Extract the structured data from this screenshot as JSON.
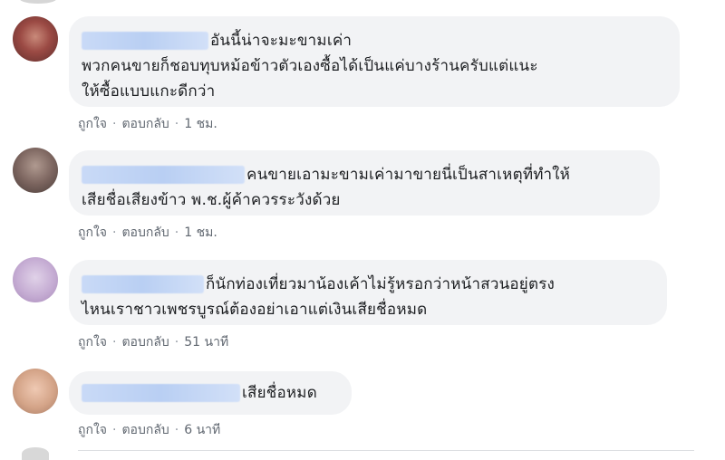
{
  "comments": [
    {
      "lines": [
        "อันนี้น่าจะมะขามเค่า",
        "พวกคนขายก็ชอบทุบหม้อข้าวตัวเองซื้อได้เป็นแค่บางร้านครับแต่แนะ",
        "ให้ซื้อแบบแกะดีกว่า"
      ],
      "like": "ถูกใจ",
      "reply": "ตอบกลับ",
      "time": "1 ชม.",
      "avatar_color": "#a0504a"
    },
    {
      "lines": [
        "คนขายเอามะขามเค่ามาขายนี่เป็นสาเหตุที่ทำให้",
        "เสียชื่อเสียงข้าว พ.ช.ผู้ค้าควรระวังด้วย"
      ],
      "like": "ถูกใจ",
      "reply": "ตอบกลับ",
      "time": "1 ชม.",
      "avatar_color": "#8a6f66"
    },
    {
      "lines": [
        "ก็นักท่องเที่ยวมาน้องเค้าไม่รู้หรอกว่าหน้าสวนอยู่ตรง",
        "ไหนเราชาวเพชรบูรณ์ต้องอย่าเอาแต่เงินเสียชื่อหมด"
      ],
      "like": "ถูกใจ",
      "reply": "ตอบกลับ",
      "time": "51 นาที",
      "avatar_color": "#c7b2d3"
    },
    {
      "lines": [
        "เสียชื่อหมด"
      ],
      "like": "ถูกใจ",
      "reply": "ตอบกลับ",
      "time": "6 นาที",
      "avatar_color": "#d6a990"
    }
  ]
}
